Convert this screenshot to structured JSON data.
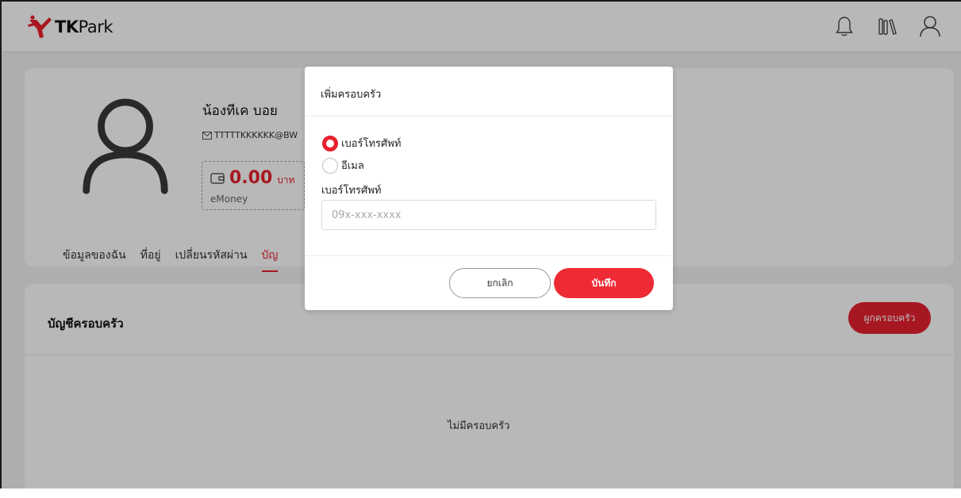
{
  "header": {
    "logo": {
      "brand_bold": "TK",
      "brand_rest": "Park"
    },
    "icons": [
      "bell-icon",
      "books-icon",
      "user-icon"
    ]
  },
  "profile": {
    "name": "น้องทีเค บอย",
    "email": "TTTTTKKKKKK@BW",
    "emoney": {
      "amount": "0.00",
      "currency": "บาท",
      "label": "eMoney"
    },
    "tabs": [
      {
        "label": "ข้อมูลของฉัน",
        "active": false
      },
      {
        "label": "ที่อยู่",
        "active": false
      },
      {
        "label": "เปลี่ยนรหัสผ่าน",
        "active": false
      },
      {
        "label": "บัญ",
        "active": true
      }
    ]
  },
  "family": {
    "title": "บัญชีครอบครัว",
    "link_button": "ผูกครอบครัว",
    "empty_text": "ไม่มีครอบครัว"
  },
  "modal": {
    "title": "เพิ่มครอบครัว",
    "options": [
      {
        "label": "เบอร์โทรศัพท์",
        "checked": true
      },
      {
        "label": "อีเมล",
        "checked": false
      }
    ],
    "field_label": "เบอร์โทรศัพท์",
    "input_value": "",
    "input_placeholder": "09x-xxx-xxxx",
    "cancel_label": "ยกเลิก",
    "save_label": "บันทึก"
  },
  "colors": {
    "accent": "#e8212e",
    "overlay": "rgba(0,0,0,0.28)"
  }
}
